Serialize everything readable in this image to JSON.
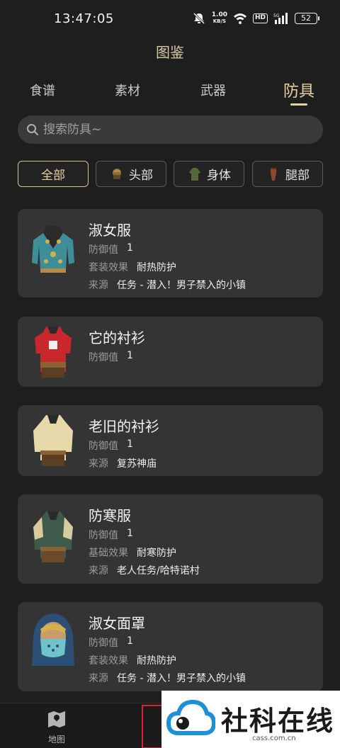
{
  "status_bar": {
    "time": "13:47:05",
    "speed_value": "1.00",
    "speed_unit": "KB/S",
    "hd_label": "HD",
    "signal_label": "5G",
    "battery": "52",
    "icons": [
      "mute-icon",
      "wifi-icon",
      "hd-icon",
      "signal-icon",
      "battery-icon"
    ]
  },
  "page_title": "图鉴",
  "tabs": [
    {
      "label": "食谱",
      "active": false
    },
    {
      "label": "素材",
      "active": false
    },
    {
      "label": "武器",
      "active": false
    },
    {
      "label": "防具",
      "active": true
    }
  ],
  "search": {
    "placeholder": "搜索防具~",
    "value": "",
    "icon": "search-icon"
  },
  "filters": [
    {
      "label": "全部",
      "active": true
    },
    {
      "label": "头部",
      "icon": "helmet-icon",
      "active": false
    },
    {
      "label": "身体",
      "icon": "tunic-icon",
      "active": false
    },
    {
      "label": "腿部",
      "icon": "legs-icon",
      "active": false
    }
  ],
  "armor_items": [
    {
      "name": "淑女服",
      "rows": [
        {
          "label": "防御值",
          "value": "1"
        },
        {
          "label": "套装效果",
          "value": "耐热防护"
        },
        {
          "label": "来源",
          "value": "任务 - 潜入！男子禁入的小镇"
        }
      ]
    },
    {
      "name": "它的衬衫",
      "rows": [
        {
          "label": "防御值",
          "value": "1"
        }
      ]
    },
    {
      "name": "老旧的衬衫",
      "rows": [
        {
          "label": "防御值",
          "value": "1"
        },
        {
          "label": "来源",
          "value": "复苏神庙"
        }
      ]
    },
    {
      "name": "防寒服",
      "rows": [
        {
          "label": "防御值",
          "value": "1"
        },
        {
          "label": "基础效果",
          "value": "耐寒防护"
        },
        {
          "label": "来源",
          "value": "老人任务/哈特诺村"
        }
      ]
    },
    {
      "name": "淑女面罩",
      "rows": [
        {
          "label": "防御值",
          "value": "1"
        },
        {
          "label": "套装效果",
          "value": "耐热防护"
        },
        {
          "label": "来源",
          "value": "任务 - 潜入！男子禁入的小镇"
        }
      ]
    }
  ],
  "bottom_nav": {
    "map_label": "地图",
    "map_icon": "map-icon"
  },
  "watermark": {
    "text": "社科在线",
    "url": "cass.com.cn"
  },
  "colors": {
    "background": "#1e1e1e",
    "card": "#343434",
    "accent_gold": "#e6d3a1",
    "highlight_red": "#d8262a"
  }
}
